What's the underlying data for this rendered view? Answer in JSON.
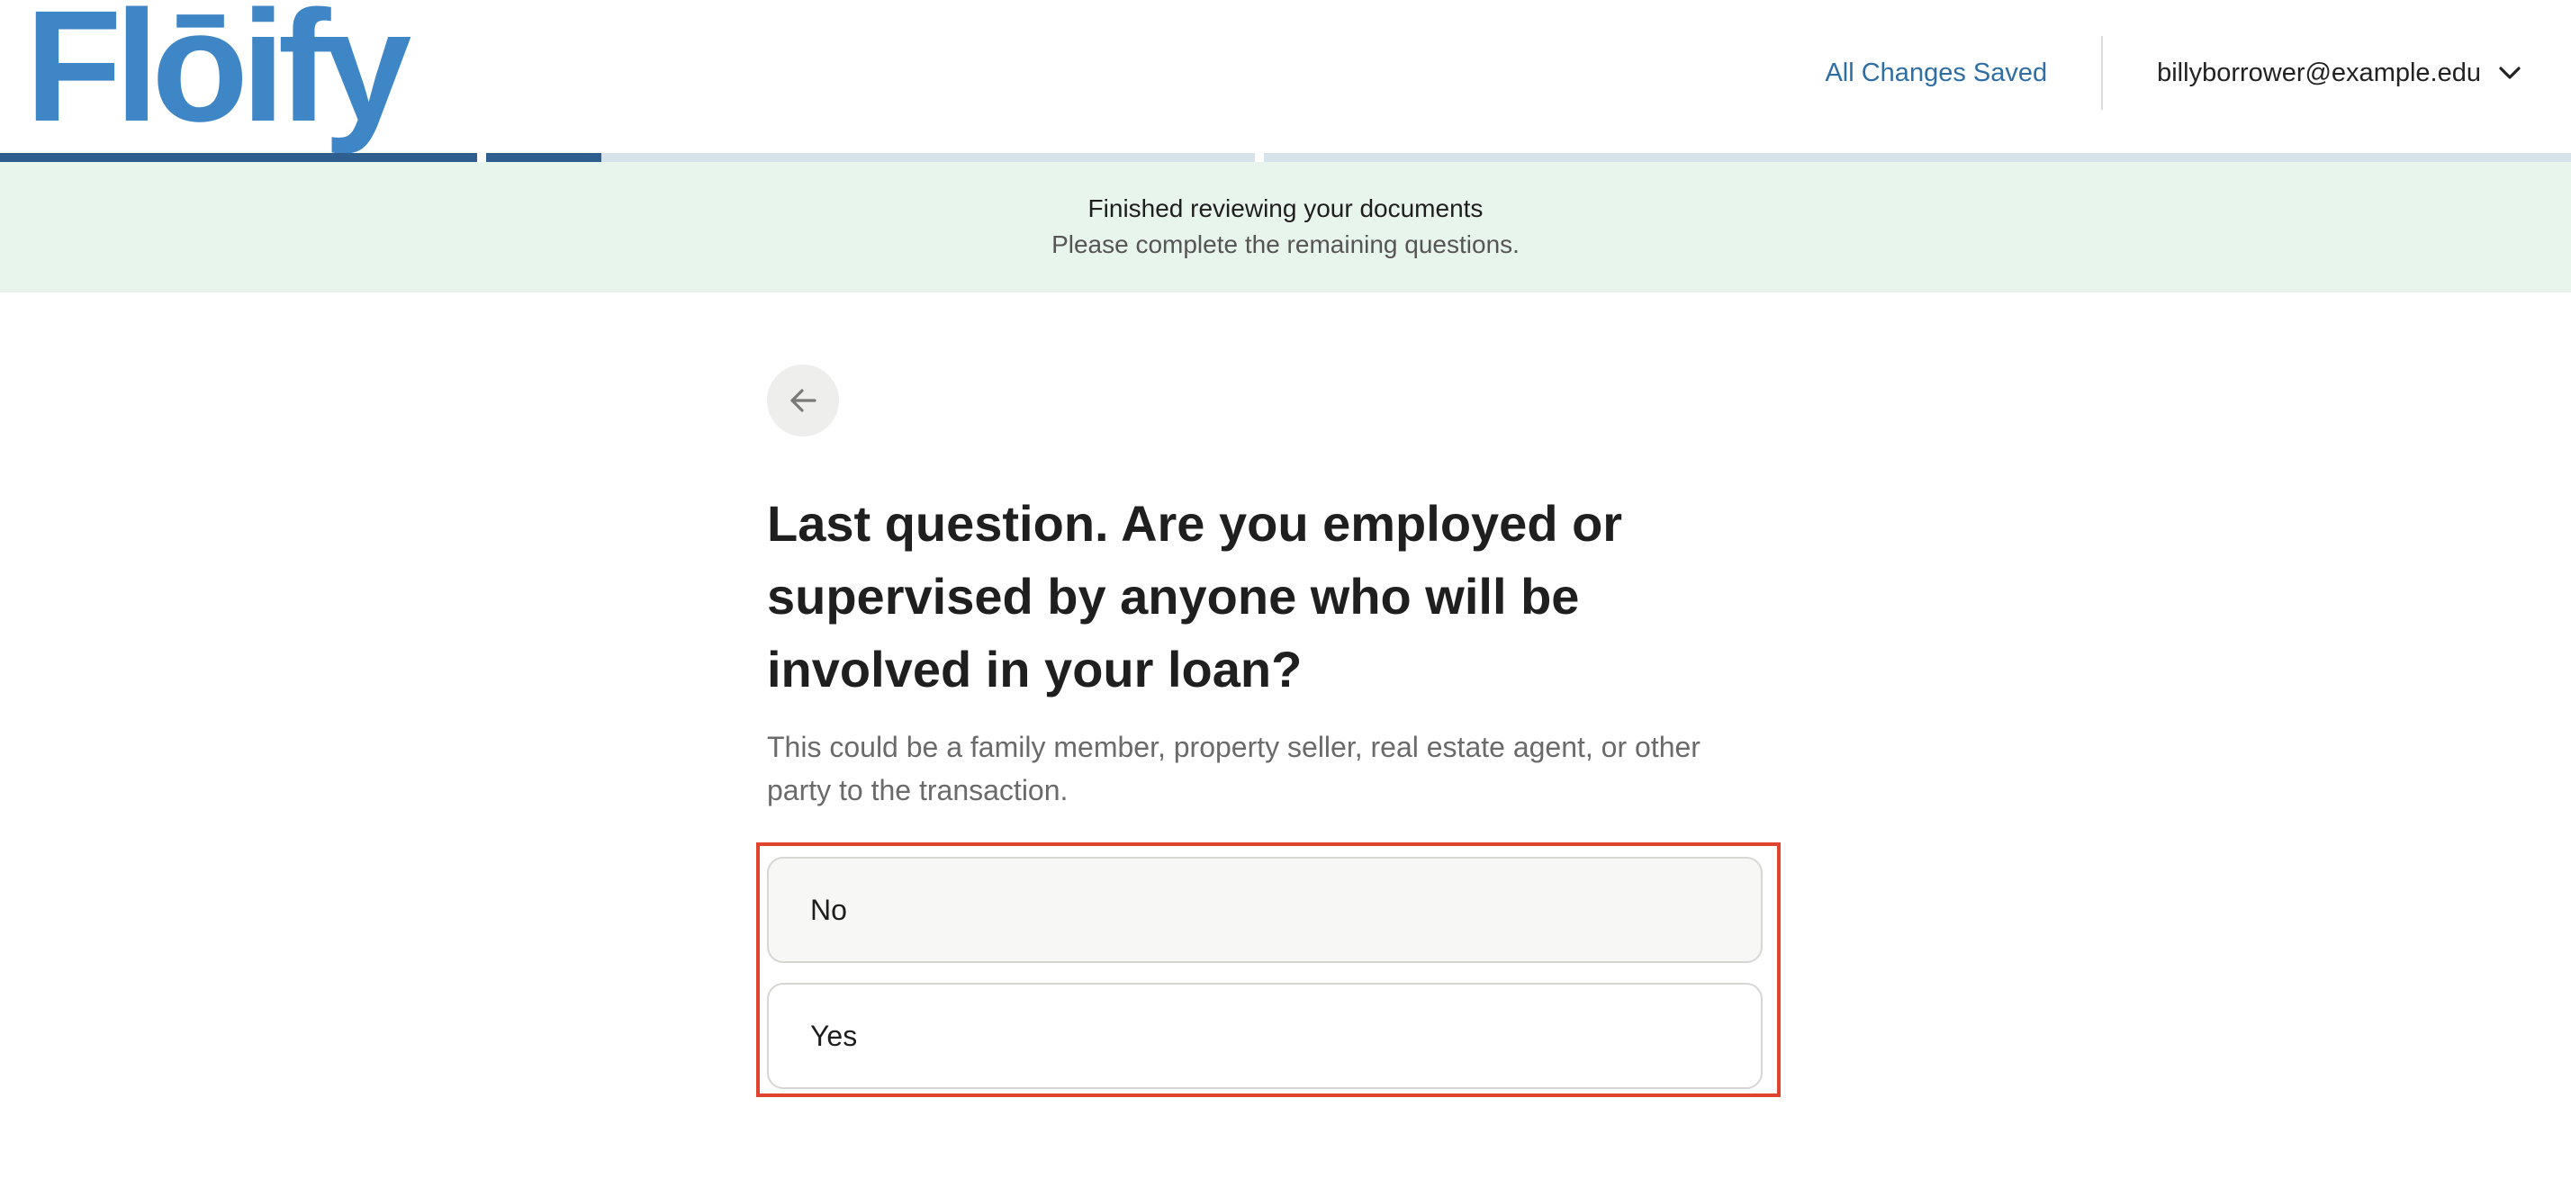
{
  "header": {
    "logo_text": "Flōify",
    "save_status": "All Changes Saved",
    "user_email": "billyborrower@example.edu",
    "user_menu_icon": "chevron-down-icon"
  },
  "progress": {
    "segments": [
      {
        "fill": 1.0
      },
      {
        "fill": 0.15
      },
      {
        "fill": 0.0
      }
    ]
  },
  "banner": {
    "title": "Finished reviewing your documents",
    "subtitle": "Please complete the remaining questions."
  },
  "question": {
    "back_icon": "arrow-left-icon",
    "title": "Last question. Are you employed or supervised by anyone who will be involved in your loan?",
    "helper": "This could be a family member, property seller, real estate agent, or other party to the transaction.",
    "options": [
      "No",
      "Yes"
    ]
  },
  "colors": {
    "brand": "#3f86c7",
    "progress_fill": "#2e5f8f",
    "banner_bg": "#e8f5ec",
    "highlight_border": "#e0442e"
  }
}
